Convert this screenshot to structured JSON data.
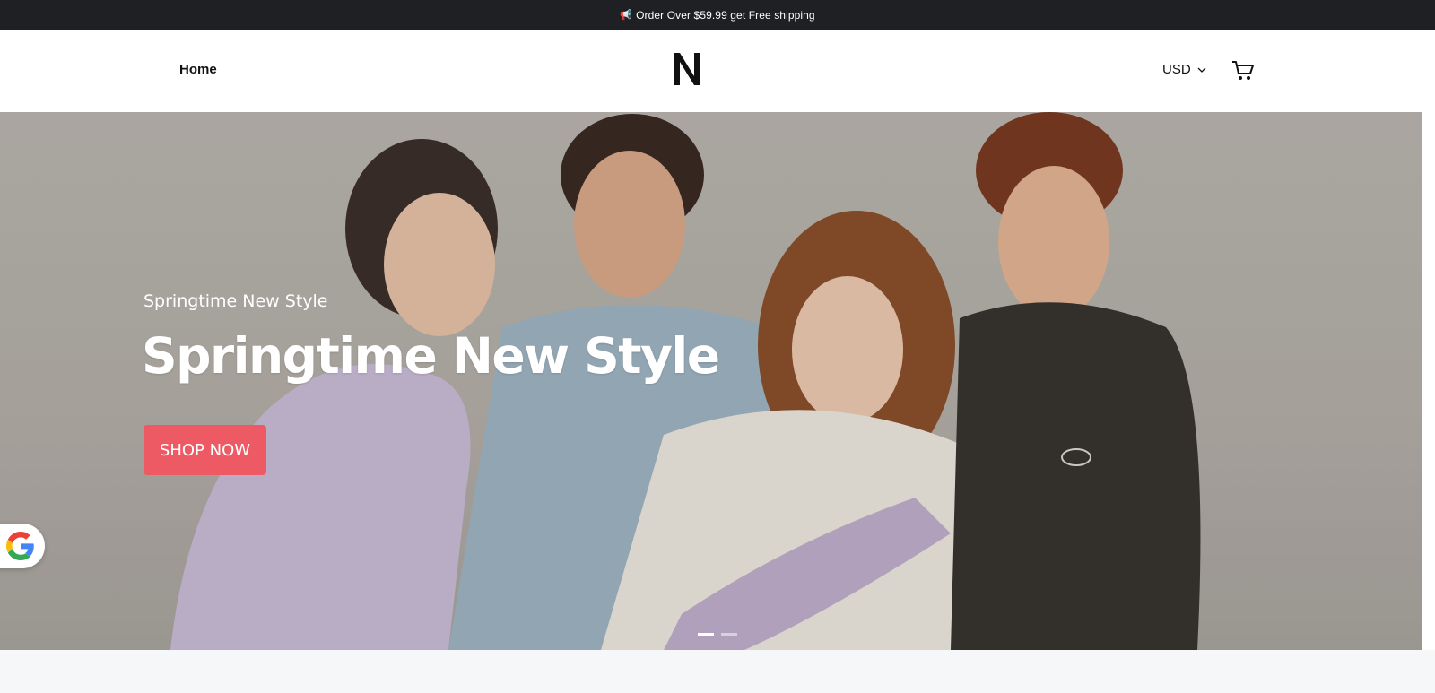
{
  "announcement": {
    "icon": "megaphone-icon",
    "text": "Order Over $59.99 get Free shipping"
  },
  "header": {
    "nav": [
      {
        "label": "Home"
      }
    ],
    "logo_letter": "N",
    "currency": "USD",
    "cart_icon": "cart-icon"
  },
  "hero": {
    "subtitle": "Springtime New Style",
    "title": "Springtime New Style",
    "cta_label": "SHOP NOW",
    "cta_color": "#ee5a64",
    "slides_total": 2,
    "active_slide": 1
  },
  "colors": {
    "announcement_bg": "#1f2023",
    "page_bg": "#f6f7f9"
  },
  "google_badge": {
    "icon": "google-icon"
  },
  "section_heading_peek": ""
}
